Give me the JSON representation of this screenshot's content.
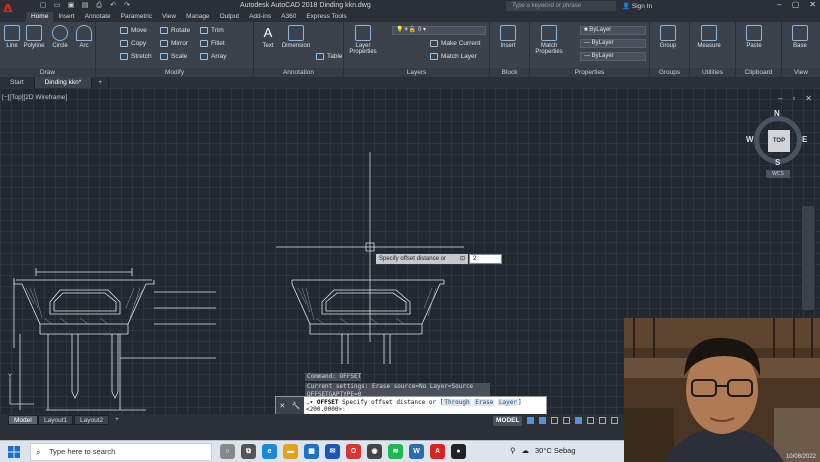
{
  "app": {
    "logo": "A",
    "title": "Autodesk AutoCAD 2018   Dinding kkn.dwg",
    "search_placeholder": "Type a keyword or phrase",
    "sign_in": "Sign In"
  },
  "ribbon_tabs": [
    "Home",
    "Insert",
    "Annotate",
    "Parametric",
    "View",
    "Manage",
    "Output",
    "Add-ins",
    "A360",
    "Express Tools"
  ],
  "ribbon": {
    "draw": {
      "label": "Draw",
      "tools": [
        "Line",
        "Polyline",
        "Circle",
        "Arc"
      ]
    },
    "modify": {
      "label": "Modify",
      "rows": [
        [
          "Move",
          "Rotate",
          "Trim"
        ],
        [
          "Copy",
          "Mirror",
          "Fillet"
        ],
        [
          "Stretch",
          "Scale",
          "Array"
        ]
      ]
    },
    "annotation": {
      "label": "Annotation",
      "tools": [
        "Text",
        "Dimension"
      ],
      "table": "Table"
    },
    "layers": {
      "label": "Layers",
      "tool": "Layer Properties",
      "current_layer": "0",
      "make_current": "Make Current",
      "match_layer": "Match Layer"
    },
    "block": {
      "label": "Block",
      "tool": "Insert"
    },
    "properties": {
      "label": "Properties",
      "tool": "Match Properties",
      "color": "ByLayer",
      "linetype": "ByLayer",
      "lineweight": "ByLayer"
    },
    "groups": {
      "label": "Groups",
      "tool": "Group"
    },
    "utilities": {
      "label": "Utilities",
      "tool": "Measure"
    },
    "clipboard": {
      "label": "Clipboard",
      "tool": "Paste"
    },
    "view": {
      "label": "View",
      "tool": "Base"
    }
  },
  "file_tabs": [
    "Start",
    "Dinding kkn*"
  ],
  "viewport": {
    "label": "[−][Top][2D Wireframe]",
    "viewcube": {
      "top": "TOP",
      "n": "N",
      "s": "S",
      "e": "E",
      "w": "W",
      "wcs": "WCS"
    }
  },
  "dynamic_prompt": {
    "text": "Specify offset distance or",
    "value": "2"
  },
  "command_history": [
    "Command: OFFSET",
    "Current settings: Erase source=No  Layer=Source  OFFSETGAPTYPE=0"
  ],
  "command_line": {
    "command": "OFFSET",
    "prompt": "Specify offset distance or",
    "options": [
      "Through",
      "Erase",
      "Layer"
    ],
    "default": "<200.0000>:"
  },
  "layout_tabs": [
    "Model",
    "Layout1",
    "Layout2"
  ],
  "status_bar": {
    "mode": "MODEL"
  },
  "taskbar": {
    "search_placeholder": "Type here to search",
    "weather": "30°C  Sebag",
    "date": "10/08/2022"
  },
  "colors": {
    "canvas": "#212830",
    "ribbon": "#3c424c",
    "accent": "#d8231e",
    "drawing_lines": "#e8e8e8"
  }
}
